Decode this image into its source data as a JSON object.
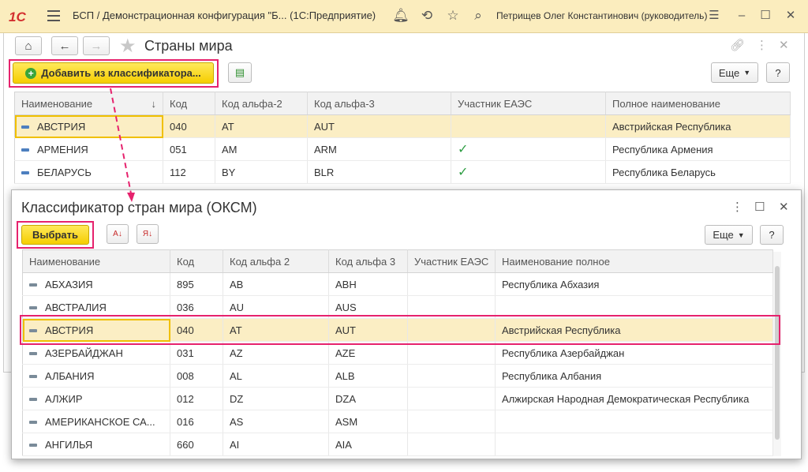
{
  "app": {
    "logo": "1С",
    "title": "БСП / Демонстрационная конфигурация \"Б...  (1С:Предприятие)",
    "user": "Петрищев Олег Константинович (руководитель)"
  },
  "form": {
    "title": "Страны мира",
    "add_button": "Добавить из классификатора...",
    "more_button": "Еще",
    "help_button": "?",
    "columns": [
      "Наименование",
      "Код",
      "Код альфа-2",
      "Код альфа-3",
      "Участник ЕАЭС",
      "Полное наименование"
    ],
    "rows": [
      {
        "name": "АВСТРИЯ",
        "code": "040",
        "a2": "AT",
        "a3": "AUT",
        "eaeu": "",
        "full": "Австрийская Республика"
      },
      {
        "name": "АРМЕНИЯ",
        "code": "051",
        "a2": "AM",
        "a3": "ARM",
        "eaeu": "✓",
        "full": "Республика Армения"
      },
      {
        "name": "БЕЛАРУСЬ",
        "code": "112",
        "a2": "BY",
        "a3": "BLR",
        "eaeu": "✓",
        "full": "Республика Беларусь"
      }
    ]
  },
  "dialog": {
    "title": "Классификатор стран мира (ОКСМ)",
    "select_button": "Выбрать",
    "more_button": "Еще",
    "help_button": "?",
    "columns": [
      "Наименование",
      "Код",
      "Код альфа 2",
      "Код альфа 3",
      "Участник ЕАЭС",
      "Наименование полное"
    ],
    "rows": [
      {
        "name": "АБХАЗИЯ",
        "code": "895",
        "a2": "AB",
        "a3": "ABH",
        "eaeu": "",
        "full": "Республика Абхазия"
      },
      {
        "name": "АВСТРАЛИЯ",
        "code": "036",
        "a2": "AU",
        "a3": "AUS",
        "eaeu": "",
        "full": ""
      },
      {
        "name": "АВСТРИЯ",
        "code": "040",
        "a2": "AT",
        "a3": "AUT",
        "eaeu": "",
        "full": "Австрийская Республика"
      },
      {
        "name": "АЗЕРБАЙДЖАН",
        "code": "031",
        "a2": "AZ",
        "a3": "AZE",
        "eaeu": "",
        "full": "Республика Азербайджан"
      },
      {
        "name": "АЛБАНИЯ",
        "code": "008",
        "a2": "AL",
        "a3": "ALB",
        "eaeu": "",
        "full": "Республика Албания"
      },
      {
        "name": "АЛЖИР",
        "code": "012",
        "a2": "DZ",
        "a3": "DZA",
        "eaeu": "",
        "full": "Алжирская Народная Демократическая Республика"
      },
      {
        "name": "АМЕРИКАНСКОЕ СА...",
        "code": "016",
        "a2": "AS",
        "a3": "ASM",
        "eaeu": "",
        "full": ""
      },
      {
        "name": "АНГИЛЬЯ",
        "code": "660",
        "a2": "AI",
        "a3": "AIA",
        "eaeu": "",
        "full": ""
      }
    ]
  },
  "colors": {
    "accent_yellow": "#f5cd00",
    "highlight": "#e6226d",
    "titlebar": "#fbedbe",
    "selected_row": "#fbeec4"
  }
}
